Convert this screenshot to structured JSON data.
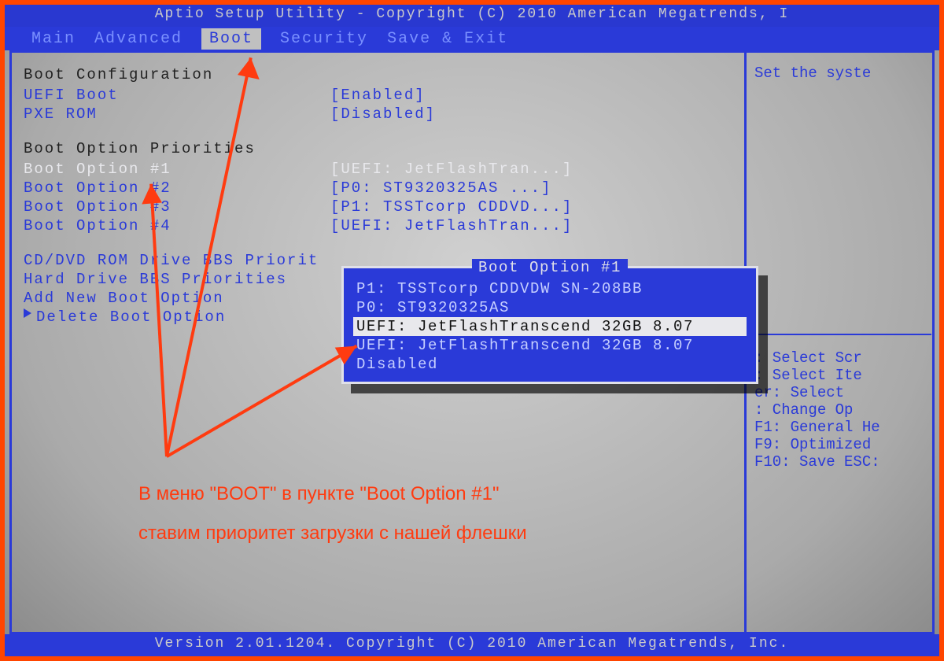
{
  "header": "Aptio Setup Utility - Copyright (C) 2010 American Megatrends, I",
  "footer": "Version 2.01.1204. Copyright (C) 2010 American Megatrends, Inc.",
  "tabs": [
    "Main",
    "Advanced",
    "Boot",
    "Security",
    "Save & Exit"
  ],
  "active_tab": "Boot",
  "sections": {
    "boot_config_title": "Boot Configuration",
    "boot_config": [
      {
        "label": "UEFI Boot",
        "value": "[Enabled]"
      },
      {
        "label": "PXE ROM",
        "value": "[Disabled]"
      }
    ],
    "priorities_title": "Boot Option Priorities",
    "priorities": [
      {
        "label": "Boot Option #1",
        "value": "[UEFI: JetFlashTran...]",
        "highlight": true
      },
      {
        "label": "Boot Option #2",
        "value": "[P0: ST9320325AS   ...]"
      },
      {
        "label": "Boot Option #3",
        "value": "[P1: TSSTcorp CDDVD...]"
      },
      {
        "label": "Boot Option #4",
        "value": "[UEFI: JetFlashTran...]"
      }
    ],
    "links": [
      "CD/DVD ROM Drive BBS Priorit",
      "Hard Drive BBS Priorities",
      "Add New Boot Option",
      "Delete Boot Option"
    ]
  },
  "popup": {
    "title": "Boot Option #1",
    "items": [
      "P1: TSSTcorp CDDVDW SN-208BB",
      "P0: ST9320325AS",
      "UEFI: JetFlashTranscend 32GB 8.07",
      "UEFI: JetFlashTranscend 32GB 8.07",
      "Disabled"
    ],
    "selected_index": 2
  },
  "help": {
    "top": "Set the syste",
    "hints": [
      ": Select Scr",
      ": Select Ite",
      "er: Select",
      ": Change Op",
      "F1: General He",
      "F9: Optimized ",
      "F10: Save  ESC:"
    ]
  },
  "annotation": {
    "line1": "В меню \"BOOT\" в пункте \"Boot Option #1\"",
    "line2": "ставим приоритет загрузки с нашей флешки"
  }
}
